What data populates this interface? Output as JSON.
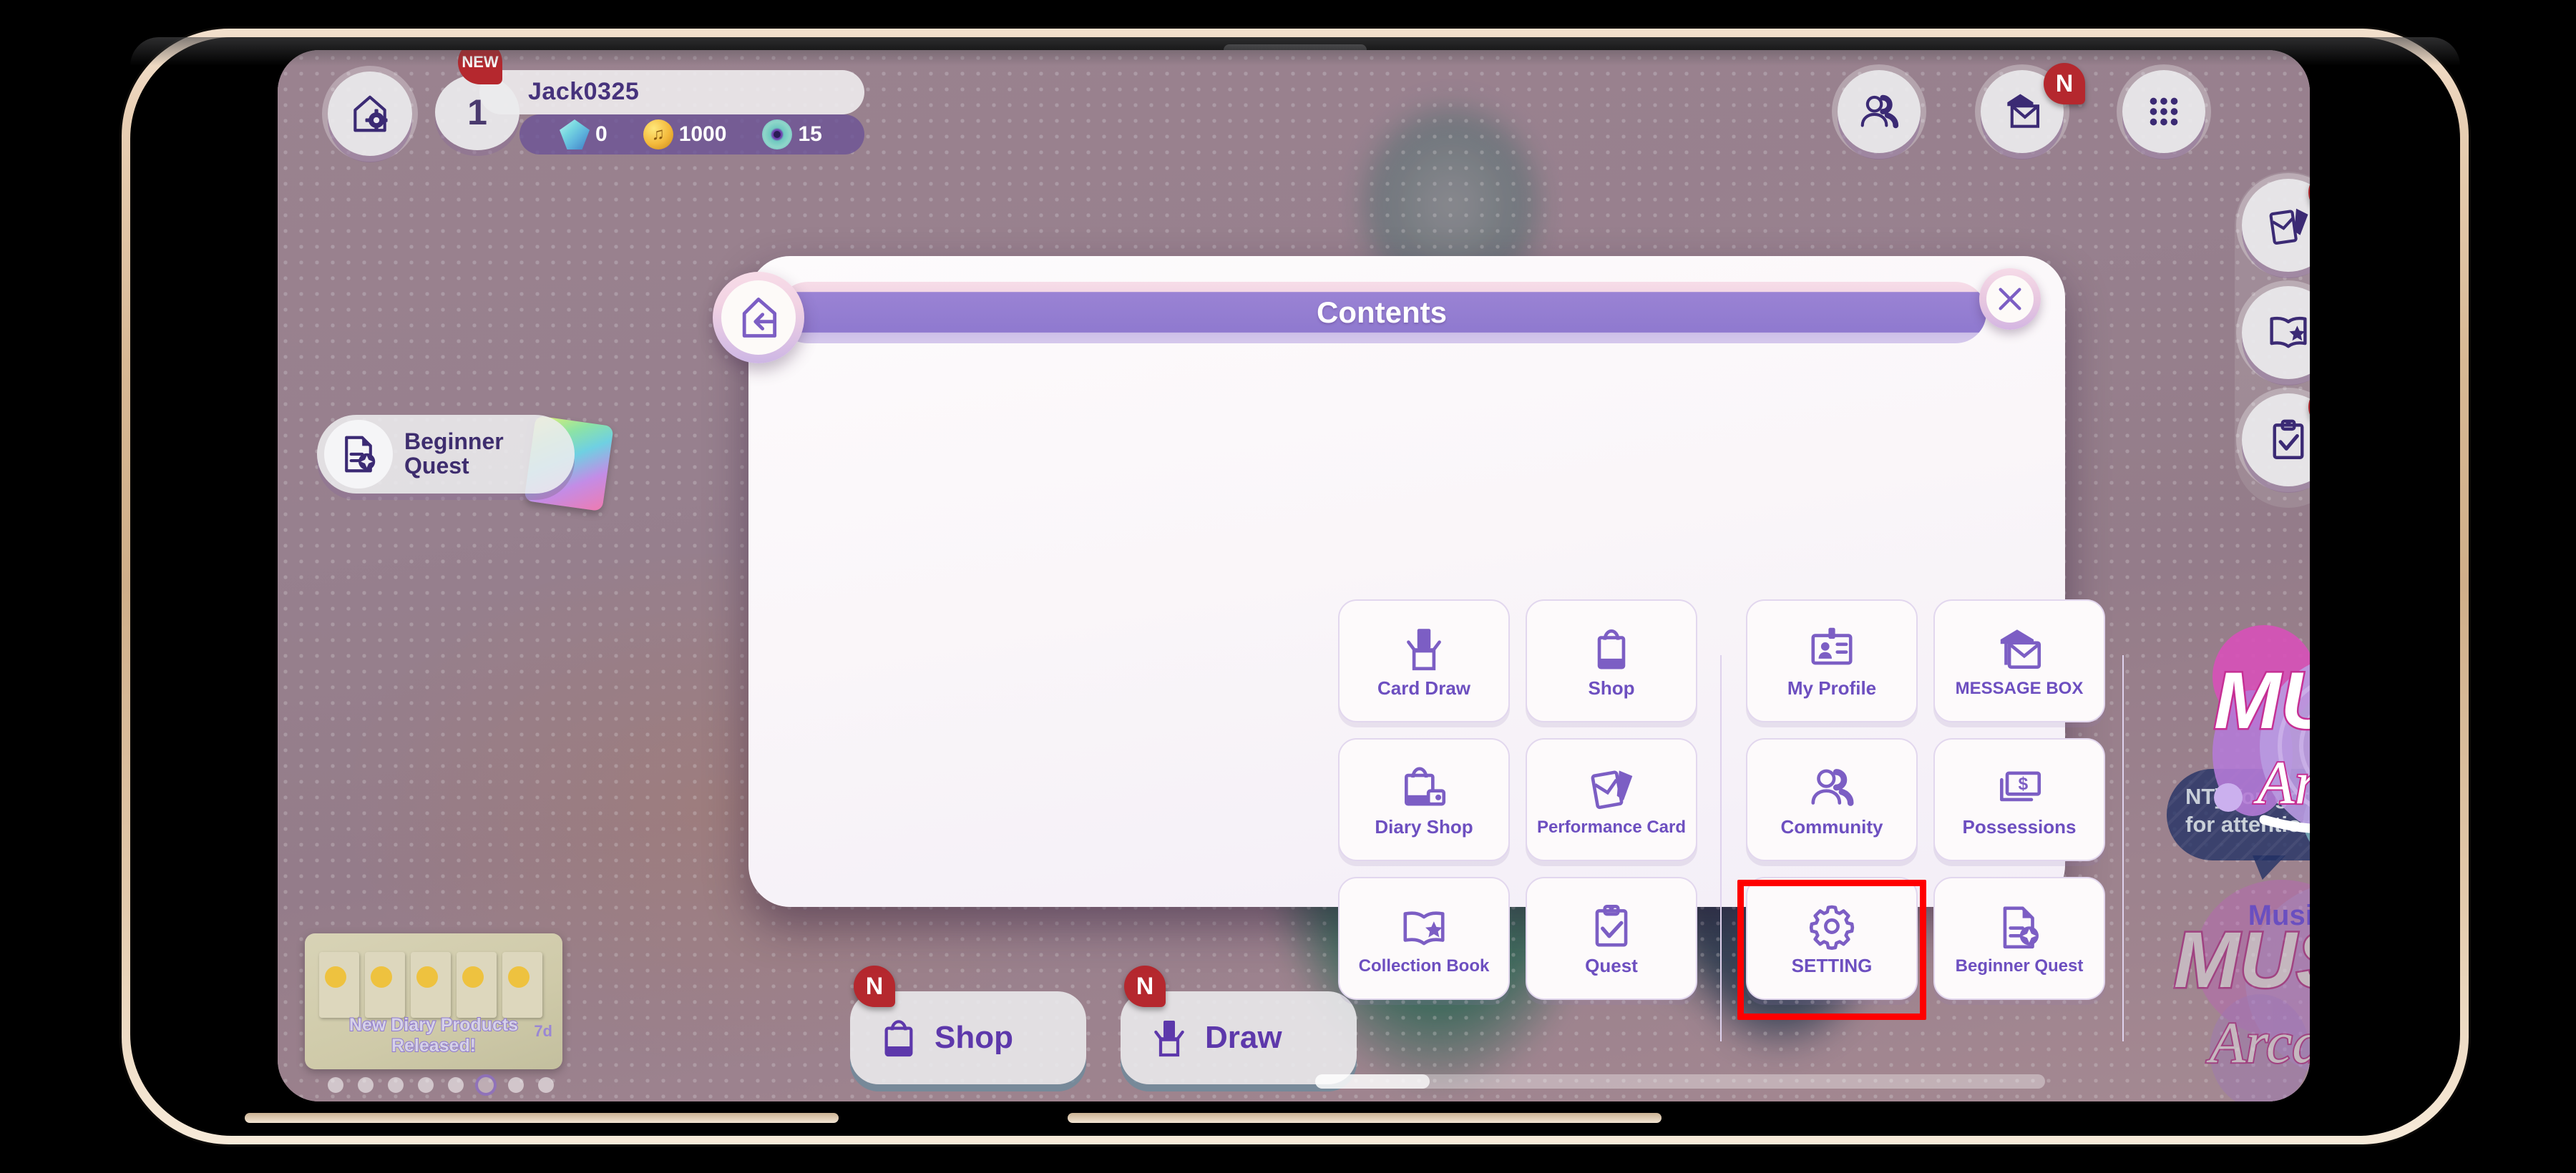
{
  "hud": {
    "home_settings_icon": "home-gear-icon",
    "level": "1",
    "username": "Jack0325",
    "currencies": [
      {
        "icon": "gem-icon",
        "value": "0"
      },
      {
        "icon": "coin-icon",
        "value": "1000"
      },
      {
        "icon": "disc-icon",
        "value": "15"
      }
    ],
    "friends_icon": "friends-icon",
    "mail_icon": "mail-icon",
    "mail_badge": "N",
    "menu_icon": "grid-menu-icon"
  },
  "side_dock": [
    {
      "icon": "performance-card-icon",
      "badge": "N"
    },
    {
      "icon": "collection-book-icon",
      "badge": ""
    },
    {
      "icon": "quest-clipboard-icon",
      "badge": "N"
    }
  ],
  "quest_pill": {
    "icon": "beginner-quest-icon",
    "line1": "Beginner",
    "line2": "Quest"
  },
  "chat_bubble": {
    "text": "NT] You got me ing for attention"
  },
  "banner": {
    "title": "New Diary Products Released!",
    "duration": "7d",
    "badge": "NEW",
    "page_dots": 8,
    "active_dot": 6
  },
  "bottom_actions": [
    {
      "icon": "shop-bag-icon",
      "label": "Shop",
      "badge": "N"
    },
    {
      "icon": "card-draw-icon",
      "label": "Draw",
      "badge": "N"
    }
  ],
  "modal": {
    "title": "Contents",
    "back_icon": "home-back-icon",
    "close_icon": "close-icon",
    "columns": [
      {
        "id": "col-a",
        "tiles": [
          {
            "icon": "card-draw-icon",
            "label": "Card Draw"
          },
          {
            "icon": "diary-shop-icon",
            "label": "Diary Shop"
          },
          {
            "icon": "collection-book-icon",
            "label": "Collection Book"
          }
        ]
      },
      {
        "id": "col-b",
        "tiles": [
          {
            "icon": "shop-bag-icon",
            "label": "Shop"
          },
          {
            "icon": "performance-card-icon",
            "label": "Performance Card"
          },
          {
            "icon": "quest-clipboard-icon",
            "label": "Quest"
          }
        ]
      },
      {
        "id": "col-c",
        "tiles": [
          {
            "icon": "profile-id-icon",
            "label": "My Profile"
          },
          {
            "icon": "community-icon",
            "label": "Community"
          },
          {
            "icon": "gear-icon",
            "label": "SETTING",
            "highlighted": true
          }
        ]
      },
      {
        "id": "col-d",
        "tiles": [
          {
            "icon": "mail-open-icon",
            "label": "MESSAGE BOX"
          },
          {
            "icon": "money-bill-icon",
            "label": "Possessions"
          },
          {
            "icon": "beginner-quest-icon",
            "label": "Beginner Quest"
          }
        ]
      }
    ],
    "promo": {
      "logo_main": "MUSIC",
      "logo_script": "Arcade",
      "caption": "Music Arcade"
    }
  },
  "colors": {
    "accent_purple": "#6d4fc0",
    "title_bar": "#8f79cf",
    "highlight_red": "#ff0000",
    "badge_red": "#b5282e",
    "tile_bg": "#fdfafb"
  }
}
